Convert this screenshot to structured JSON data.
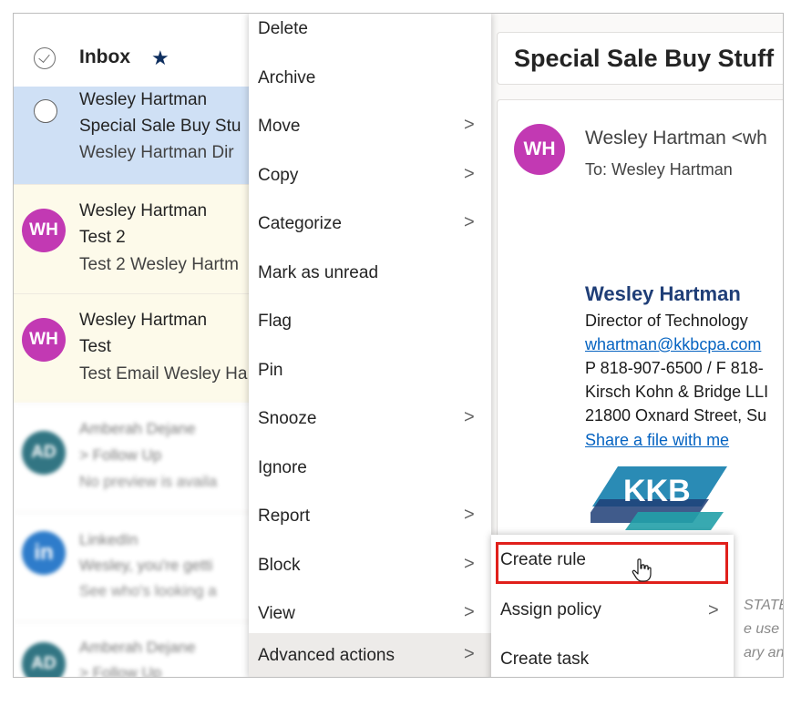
{
  "list": {
    "title": "Inbox",
    "star_icon": "star-icon",
    "rows": [
      {
        "sender": "Wesley Hartman",
        "subject": "Special Sale Buy Stu",
        "preview": "Wesley Hartman Dir",
        "bg": "#cfe0f5",
        "state": "selected"
      },
      {
        "initials": "WH",
        "sender": "Wesley Hartman",
        "subject": "Test 2",
        "preview": "Test 2 Wesley Hartm",
        "bg": "#fdfaea",
        "avatar_color": "#c239b3"
      },
      {
        "initials": "WH",
        "sender": "Wesley Hartman",
        "subject": "Test",
        "preview": "Test Email Wesley Ha",
        "bg": "#fdfaea",
        "avatar_color": "#c239b3"
      },
      {
        "initials": "AD",
        "sender": "Amberah Dejane",
        "subject": "> Follow Up",
        "preview": "No preview is availa",
        "bg": "#ffffff",
        "avatar_color": "#0f5e6e"
      },
      {
        "initials": "in",
        "sender": "LinkedIn",
        "subject": "Wesley, you're getti",
        "preview": "See who's looking a",
        "bg": "#ffffff",
        "avatar_color": "#0a66c2"
      },
      {
        "initials": "AD",
        "sender": "Amberah Dejane",
        "subject": "> Follow Up",
        "preview": "",
        "bg": "#ffffff",
        "avatar_color": "#0f5e6e"
      }
    ]
  },
  "menu": {
    "items": [
      {
        "label": "Delete",
        "submenu": false
      },
      {
        "label": "Archive",
        "submenu": false
      },
      {
        "label": "Move",
        "submenu": true
      },
      {
        "label": "Copy",
        "submenu": true
      },
      {
        "label": "Categorize",
        "submenu": true
      },
      {
        "label": "Mark as unread",
        "submenu": false
      },
      {
        "label": "Flag",
        "submenu": false
      },
      {
        "label": "Pin",
        "submenu": false
      },
      {
        "label": "Snooze",
        "submenu": true
      },
      {
        "label": "Ignore",
        "submenu": false
      },
      {
        "label": "Report",
        "submenu": true
      },
      {
        "label": "Block",
        "submenu": true
      },
      {
        "label": "View",
        "submenu": true
      },
      {
        "label": "Advanced actions",
        "submenu": true
      }
    ],
    "chevron": ">"
  },
  "submenu": {
    "items": [
      {
        "label": "Create rule",
        "submenu": false,
        "highlighted": true
      },
      {
        "label": "Assign policy",
        "submenu": true
      },
      {
        "label": "Create task",
        "submenu": false
      }
    ]
  },
  "reading": {
    "subject": "Special Sale Buy Stuff",
    "from_initials": "WH",
    "from": "Wesley Hartman <wh",
    "to": "To:  Wesley Hartman",
    "signature": {
      "name": "Wesley Hartman",
      "title": "Director of Technology",
      "email": "whartman@kkbcpa.com",
      "phone": "P 818-907-6500 / F 818-",
      "company": "Kirsch Kohn & Bridge LLI",
      "address": "21800 Oxnard Street, Su",
      "share_link": "Share a file with me",
      "logo_text": "KKB"
    },
    "disclaimer": [
      "STATE",
      "e use o",
      "ary and"
    ]
  },
  "colors": {
    "accent_red": "#e0201b",
    "avatar_purple": "#c239b3",
    "selected_row": "#cfe0f5",
    "unread_row": "#fdfaea"
  }
}
